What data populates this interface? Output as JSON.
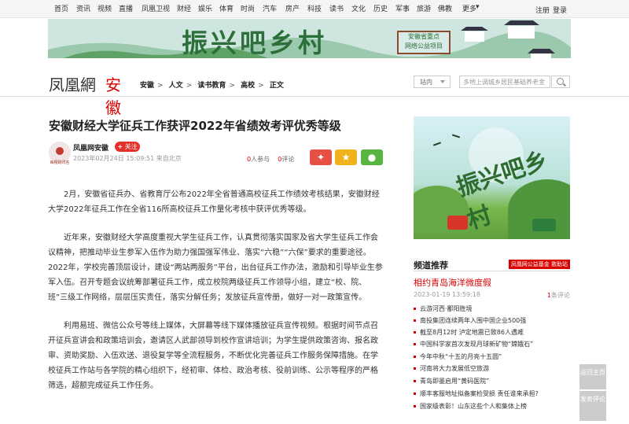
{
  "topnav": {
    "items": [
      "首页",
      "资讯",
      "视频",
      "直播",
      "凤凰卫视",
      "财经",
      "娱乐",
      "体育",
      "时尚",
      "汽车",
      "房产",
      "科技",
      "读书",
      "文化",
      "历史",
      "军事",
      "旅游",
      "佛教",
      "更多"
    ],
    "login": "注册",
    "register": "登录"
  },
  "banner": {
    "title": "振兴吧乡村",
    "stamp_line1": "安徽省重点",
    "stamp_line2": "网络公益项目"
  },
  "logo": {
    "brand": "凤凰網",
    "province": "安徽"
  },
  "breadcrumb": [
    "安徽",
    "人文",
    "读书教育",
    "高校",
    "正文"
  ],
  "search": {
    "scope": "站内",
    "placeholder": "多地上调城乡居民基础养老金"
  },
  "article": {
    "title": "安徽财经大学征兵工作获评2022年省绩效考评优秀等级",
    "author": "凤凰网安徽",
    "avatar_text": "每视财讯名",
    "follow": "关注",
    "date": "2023年02月24日 15:09:51 来自北京",
    "participants": "0",
    "participants_label": "人参与",
    "comments": "0",
    "comments_label": "评论",
    "paragraphs": [
      "2月，安徽省征兵办、省教育厅公布2022年全省普通高校征兵工作绩效考核结果，安徽财经大学2022年征兵工作在全省116所高校征兵工作量化考核中获评优秀等级。",
      "近年来，安徽财经大学高度重视大学生征兵工作，认真贯彻落实国家及省大学生征兵工作会议精神，把推动毕业生参军入伍作为助力强国强军伟业、落实“六稳”“六保”要求的重要途径。2022年，学校完善顶层设计，建设“两站两服务”平台，出台征兵工作办法，激励和引导毕业生参军入伍。召开专题会议统筹部署征兵工作，成立校院两级征兵工作领导小组，建立“校、院、班”三级工作网络，层层压实责任，落实分解任务；发放征兵宣传册，做好一对一政策宣传。",
      "利用易班、微信公众号等线上媒体，大屏幕等线下媒体播放征兵宣传视频。根据时间节点召开征兵宣讲会和政策培训会，邀请区人武部领导到校作宣讲培训；为学生提供政策咨询、报名政审、资助奖励、入伍欢送、退役复学等全流程服务，不断优化完善征兵工作服务保障措施。在学校征兵工作站与各学院的精心组织下，经初审、体检、政治考核、役前训练、公示等程序的严格筛选，超额完成征兵工作任务。"
    ]
  },
  "sidebar": {
    "ad_text": "振兴吧乡村",
    "rec_label": "频道推荐",
    "rec_tag": "凤凰网公益基金  救助站",
    "featured_title": "相约青岛海洋微度假",
    "featured_date": "2023-01-19 13:59:18",
    "featured_count": "1",
    "featured_count_label": "条评论",
    "list": [
      "云游河西·鄱阳胜境",
      "南投集团连续两年入围中国企业500强",
      "截至8月12时 泸定地震已致86人遇难",
      "中国科学家首次发现月球新矿物“嫦娥石”",
      "今年中秋“十五的月亮十五圆”",
      "河南将大力发展低空旅游",
      "青岛即墨启用“黄码医院”",
      "顺丰客服地址拟备案检受损 责任谁来承担?",
      "国家级表彰！山东这些个人和集体上榜"
    ]
  },
  "float": {
    "top": "返回主页",
    "comment": "发表评论"
  }
}
